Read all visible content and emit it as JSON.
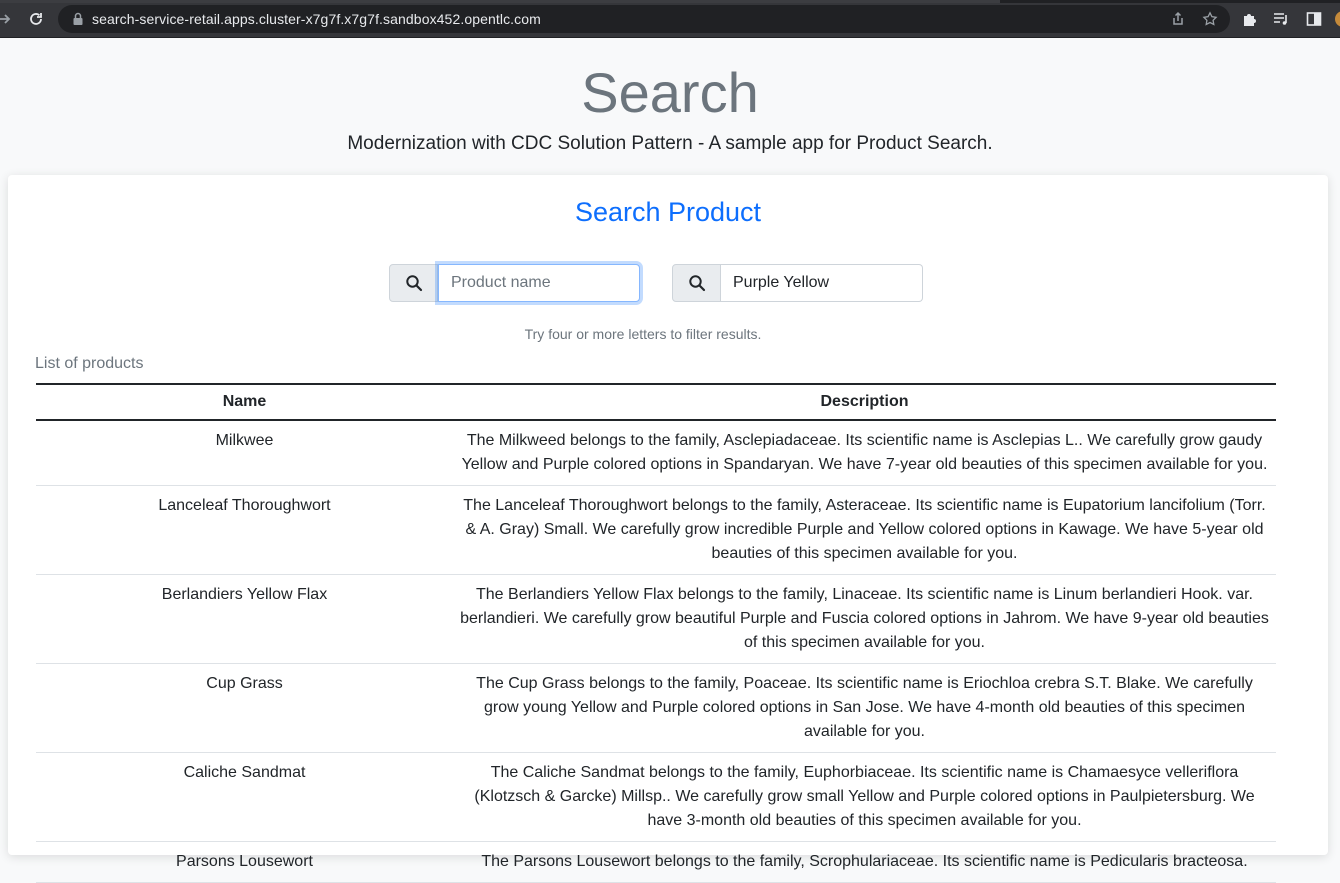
{
  "browser": {
    "url": "search-service-retail.apps.cluster-x7g7f.x7g7f.sandbox452.opentlc.com"
  },
  "header": {
    "title": "Search",
    "subtitle": "Modernization with CDC Solution Pattern - A sample app for Product Search."
  },
  "search": {
    "title": "Search Product",
    "name_placeholder": "Product name",
    "name_value": "",
    "description_value": "Purple Yellow",
    "hint": "Try four or more letters to filter results."
  },
  "products": {
    "caption": "List of products",
    "columns": [
      "Name",
      "Description"
    ],
    "rows": [
      {
        "name": "Milkwee",
        "description": "The Milkweed belongs to the family, Asclepiadaceae. Its scientific name is Asclepias L.. We carefully grow gaudy Yellow and Purple colored options in Spandaryan. We have 7-year old beauties of this specimen available for you."
      },
      {
        "name": "Lanceleaf Thoroughwort",
        "description": "The Lanceleaf Thoroughwort belongs to the family, Asteraceae. Its scientific name is Eupatorium lancifolium (Torr. & A. Gray) Small. We carefully grow incredible Purple and Yellow colored options in Kawage. We have 5-year old beauties of this specimen available for you."
      },
      {
        "name": "Berlandiers Yellow Flax",
        "description": "The Berlandiers Yellow Flax belongs to the family, Linaceae. Its scientific name is Linum berlandieri Hook. var. berlandieri. We carefully grow beautiful Purple and Fuscia colored options in Jahrom. We have 9-year old beauties of this specimen available for you."
      },
      {
        "name": "Cup Grass",
        "description": "The Cup Grass belongs to the family, Poaceae. Its scientific name is Eriochloa crebra S.T. Blake. We carefully grow young Yellow and Purple colored options in San Jose. We have 4-month old beauties of this specimen available for you."
      },
      {
        "name": "Caliche Sandmat",
        "description": "The Caliche Sandmat belongs to the family, Euphorbiaceae. Its scientific name is Chamaesyce velleriflora (Klotzsch & Garcke) Millsp.. We carefully grow small Yellow and Purple colored options in Paulpietersburg. We have 3-month old beauties of this specimen available for you."
      },
      {
        "name": "Parsons Lousewort",
        "description": "The Parsons Lousewort belongs to the family, Scrophulariaceae. Its scientific name is Pedicularis bracteosa."
      }
    ]
  }
}
